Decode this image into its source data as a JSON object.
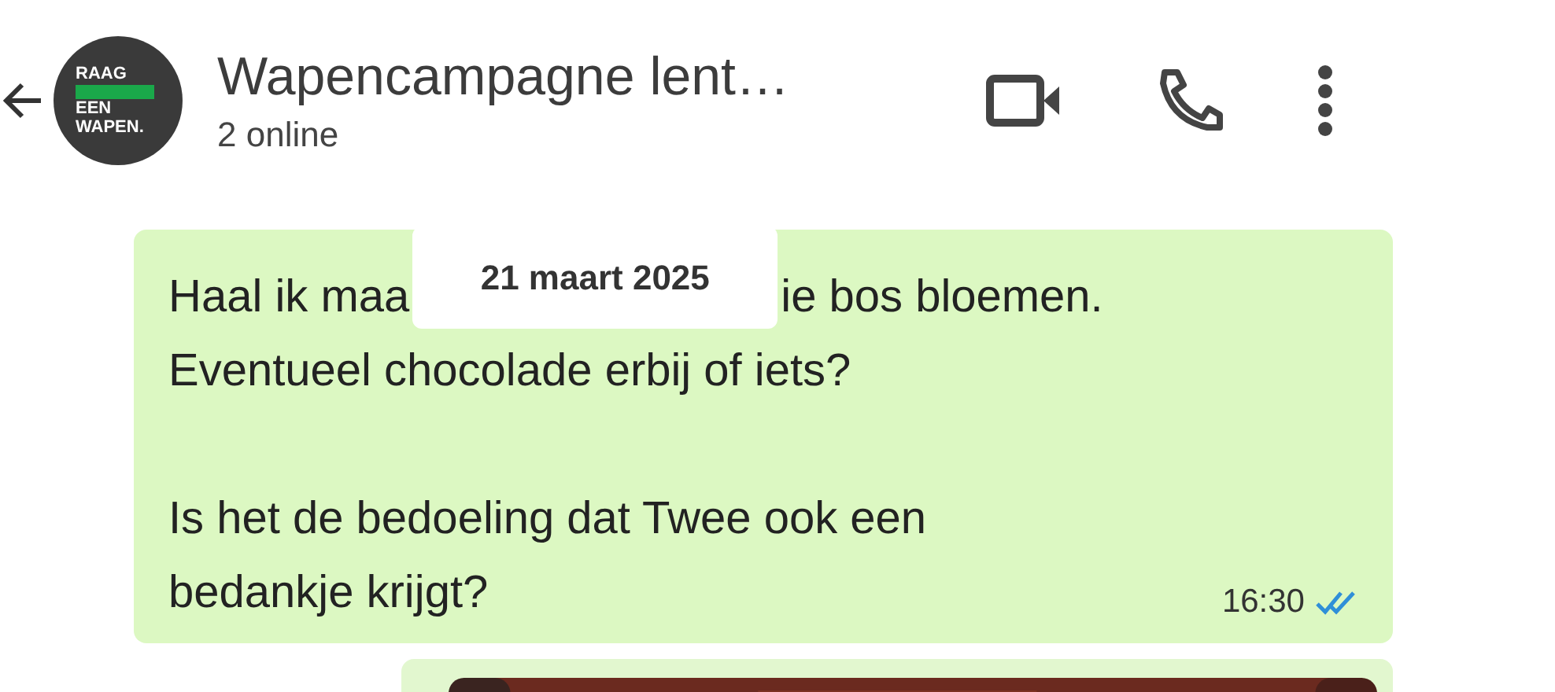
{
  "header": {
    "avatar": {
      "lines": [
        "RAAG",
        "EEN",
        "WAPEN."
      ]
    },
    "title": "Wapencampagne lent…",
    "subtitle": "2 online"
  },
  "date_badge": "21 maart 2025",
  "messages": [
    {
      "kind": "text",
      "paragraphs": [
        [
          [
            "Haal ik maa",
            "ie bos bloemen."
          ],
          [
            "Eventueel chocolade erbij of iets?"
          ]
        ],
        [
          [
            "Is het de bedoeling dat Twee ook een"
          ],
          [
            "bedankje krijgt?"
          ]
        ]
      ],
      "time": "16:30",
      "read": true
    },
    {
      "kind": "picture"
    }
  ]
}
